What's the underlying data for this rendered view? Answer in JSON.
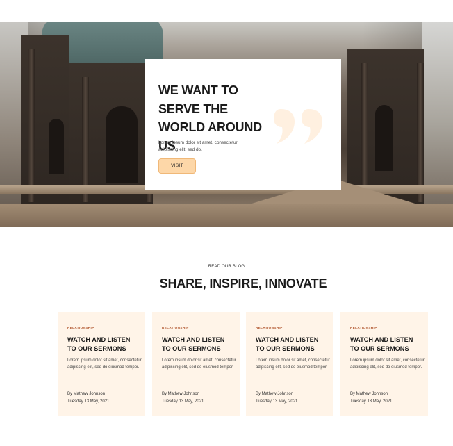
{
  "hero": {
    "title": "WE WANT TO SERVE THE WORLD AROUND US",
    "text": "Lorem ipsum dolor sit amet, consectetur adipiscing elit, sed do.",
    "button_label": "VISIT",
    "quote_icon": "quote-icon"
  },
  "blog": {
    "eyebrow": "READ OUR BLOG",
    "title": "SHARE, INSPIRE, INNOVATE",
    "cards": [
      {
        "category": "RELATIONSHIP",
        "title": "WATCH AND LISTEN TO OUR SERMONS",
        "text": "Lorem ipsum dolor sit amet, consectetur adipiscing elit, sed do eiusmod tempor.",
        "author": "By Mathew Johnson",
        "date": "Tuesday 13 May, 2021"
      },
      {
        "category": "RELATIONSHIP",
        "title": "WATCH AND LISTEN TO OUR SERMONS",
        "text": "Lorem ipsum dolor sit amet, consectetur adipiscing elit, sed do eiusmod tempor.",
        "author": "By Mathew Johnson",
        "date": "Tuesday 13 May, 2021"
      },
      {
        "category": "RELATIONSHIP",
        "title": "WATCH AND LISTEN TO OUR SERMONS",
        "text": "Lorem ipsum dolor sit amet, consectetur adipiscing elit, sed do eiusmod tempor.",
        "author": "By Mathew Johnson",
        "date": "Tuesday 13 May, 2021"
      },
      {
        "category": "RELATIONSHIP",
        "title": "WATCH AND LISTEN TO OUR SERMONS",
        "text": "Lorem ipsum dolor sit amet, consectetur adipiscing elit, sed do eiusmod tempor.",
        "author": "By Mathew Johnson",
        "date": "Tuesday 13 May, 2021"
      }
    ]
  },
  "colors": {
    "accent": "#fdd7a8",
    "card_background": "#fff4e8",
    "category": "#b0542c",
    "text_dark": "#1b1b1b"
  }
}
